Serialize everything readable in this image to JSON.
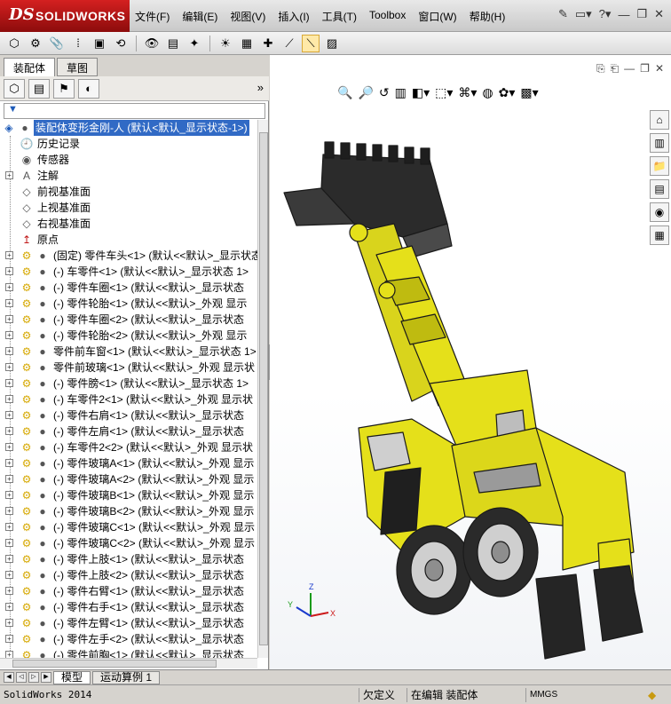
{
  "app": {
    "brand": "SOLIDWORKS",
    "menu": [
      "文件(F)",
      "编辑(E)",
      "视图(V)",
      "插入(I)",
      "工具(T)",
      "Toolbox",
      "窗口(W)",
      "帮助(H)"
    ]
  },
  "panel": {
    "tabs": [
      "装配体",
      "草图"
    ],
    "filter_icon": "filter-icon",
    "root": "装配体变形金刚-人   (默认<默认_显示状态-1>)",
    "folders": [
      {
        "label": "历史记录",
        "icon": "history-icon"
      },
      {
        "label": "传感器",
        "icon": "sensor-icon"
      },
      {
        "label": "注解",
        "icon": "annotation-icon",
        "expandable": true
      },
      {
        "label": "前视基准面",
        "icon": "plane-icon"
      },
      {
        "label": "上视基准面",
        "icon": "plane-icon"
      },
      {
        "label": "右视基准面",
        "icon": "plane-icon"
      },
      {
        "label": "原点",
        "icon": "origin-icon"
      }
    ],
    "components": [
      "(固定) 零件车头<1> (默认<<默认>_显示状态",
      "(-) 车零件<1> (默认<<默认>_显示状态 1>",
      "(-) 零件车圈<1> (默认<<默认>_显示状态",
      "(-) 零件轮胎<1> (默认<<默认>_外观 显示",
      "(-) 零件车圈<2> (默认<<默认>_显示状态",
      "(-) 零件轮胎<2> (默认<<默认>_外观 显示",
      "零件前车窗<1> (默认<<默认>_显示状态 1>",
      "零件前玻璃<1> (默认<<默认>_外观 显示状",
      "(-) 零件膀<1> (默认<<默认>_显示状态 1>",
      "(-) 车零件2<1> (默认<<默认>_外观 显示状",
      "(-) 零件右肩<1> (默认<<默认>_显示状态",
      "(-) 零件左肩<1> (默认<<默认>_显示状态",
      "(-) 车零件2<2> (默认<<默认>_外观 显示状",
      "(-) 零件玻璃A<1> (默认<<默认>_外观 显示",
      "(-) 零件玻璃A<2> (默认<<默认>_外观 显示",
      "(-) 零件玻璃B<1> (默认<<默认>_外观 显示",
      "(-) 零件玻璃B<2> (默认<<默认>_外观 显示",
      "(-) 零件玻璃C<1> (默认<<默认>_外观 显示",
      "(-) 零件玻璃C<2> (默认<<默认>_外观 显示",
      "(-) 零件上肢<1> (默认<<默认>_显示状态",
      "(-) 零件上肢<2> (默认<<默认>_显示状态",
      "(-) 零件右臂<1> (默认<<默认>_显示状态",
      "(-) 零件右手<1> (默认<<默认>_显示状态",
      "(-) 零件左臂<1> (默认<<默认>_显示状态",
      "(-) 零件左手<2> (默认<<默认>_显示状态",
      "(-) 零件前胸<1> (默认<<默认>_显示状态"
    ]
  },
  "triad": {
    "x": "X",
    "y": "Y",
    "z": "Z"
  },
  "bottom_tabs": [
    "模型",
    "运动算例 1"
  ],
  "status": {
    "app_version": "SolidWorks 2014",
    "definition": "欠定义",
    "mode": "在编辑 装配体",
    "units": "MMGS"
  },
  "colors": {
    "accent": "#316ac5",
    "model_yellow": "#e5e01a",
    "brand_red": "#c01818"
  }
}
